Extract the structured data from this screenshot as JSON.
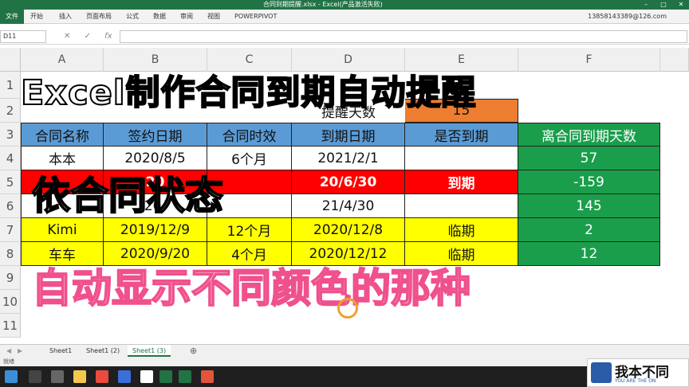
{
  "window": {
    "title": "合同到期提醒.xlsx - Excel(产品激活失败)",
    "account": "13858143389@126.com"
  },
  "ribbon_tabs": [
    "开始",
    "插入",
    "页面布局",
    "公式",
    "数据",
    "审阅",
    "视图",
    "POWERPIVOT"
  ],
  "formula_bar": {
    "name_box": "D11",
    "fx": "fx",
    "value": ""
  },
  "columns": [
    "A",
    "B",
    "C",
    "D",
    "E",
    "F"
  ],
  "rows": [
    "1",
    "2",
    "3",
    "4",
    "5",
    "6",
    "7",
    "8",
    "9",
    "10",
    "11"
  ],
  "header_row": {
    "name": "合同名称",
    "sign_date": "签约日期",
    "term": "合同时效",
    "due_date": "到期日期",
    "is_due": "是否到期",
    "days_left": "离合同到期天数"
  },
  "reminder": {
    "label": "提醒天数",
    "value": "15"
  },
  "table_rows": [
    {
      "name": "本本",
      "sign": "2020/8/5",
      "term": "6个月",
      "due": "2021/2/1",
      "status": "",
      "days": "57",
      "style": "plain"
    },
    {
      "name": "",
      "sign": "20",
      "term": "",
      "due": "20/6/30",
      "status": "到期",
      "days": "-159",
      "style": "red"
    },
    {
      "name": "",
      "sign": "20/",
      "term": "",
      "due": "21/4/30",
      "status": "",
      "days": "145",
      "style": "plain"
    },
    {
      "name": "Kimi",
      "sign": "2019/12/9",
      "term": "12个月",
      "due": "2020/12/8",
      "status": "临期",
      "days": "2",
      "style": "yellow"
    },
    {
      "name": "车车",
      "sign": "2020/9/20",
      "term": "4个月",
      "due": "2020/12/12",
      "status": "临期",
      "days": "12",
      "style": "yellow"
    }
  ],
  "overlays": {
    "title": "Excel制作合同到期自动提醒",
    "middle": "依合同状态",
    "bottom": "自动显示不同颜色的那种"
  },
  "sheet_tabs": [
    "Sheet1",
    "Sheet1 (2)",
    "Sheet1 (3)"
  ],
  "active_sheet": "Sheet1 (3)",
  "status_text": "就绪",
  "watermark": {
    "main": "我本不同",
    "sub": "YOU ARE THE ON"
  }
}
